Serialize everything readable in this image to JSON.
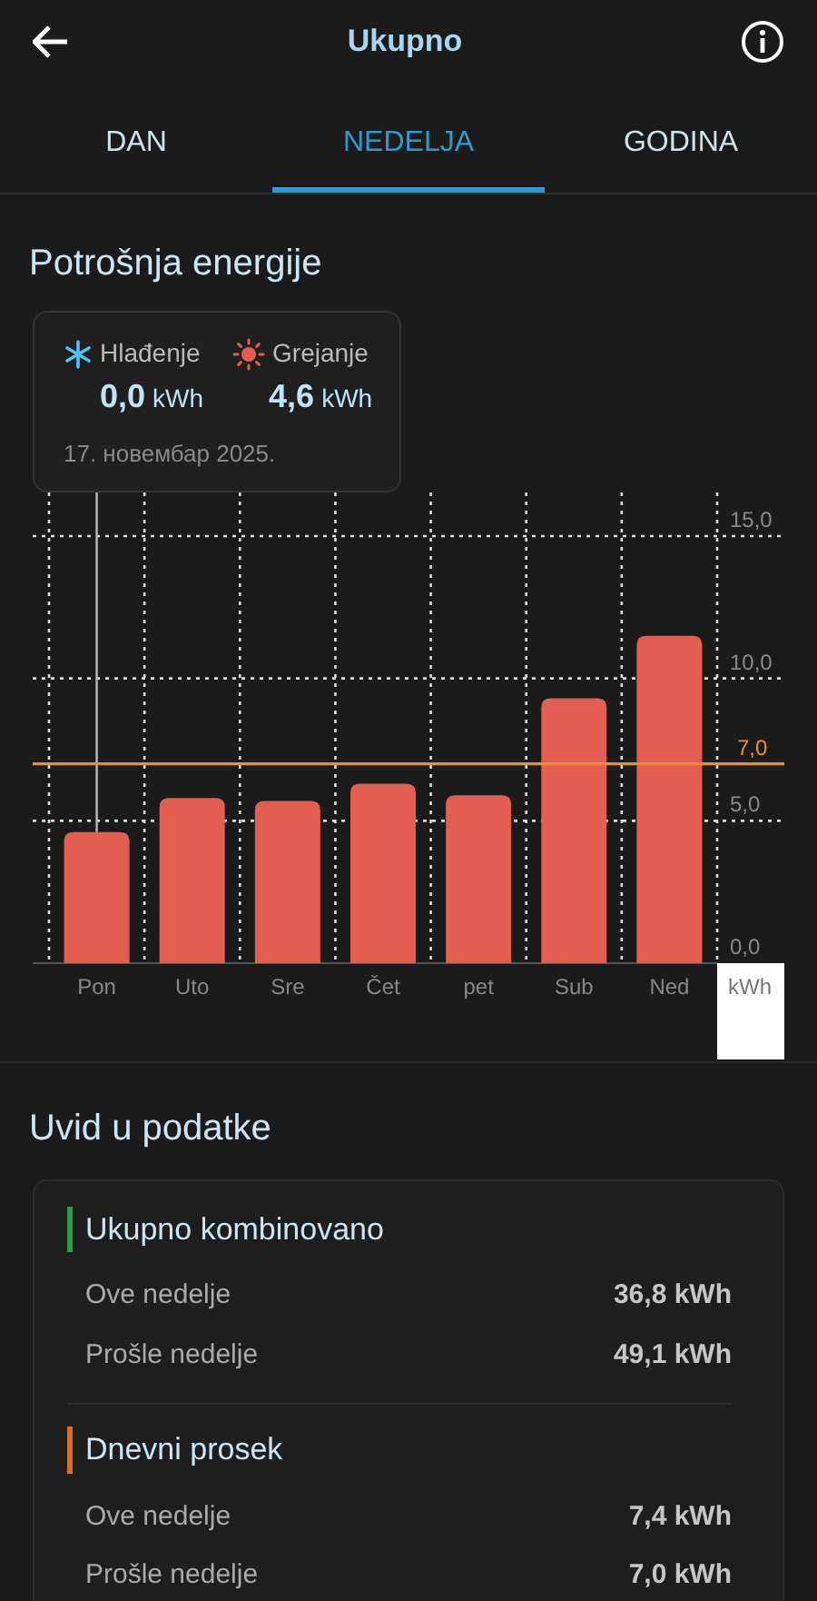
{
  "header": {
    "title": "Ukupno"
  },
  "tabs": [
    {
      "label": "DAN",
      "selected": false
    },
    {
      "label": "NEDELJA",
      "selected": true
    },
    {
      "label": "GODINA",
      "selected": false
    }
  ],
  "consumption": {
    "title": "Potrošnja energije",
    "tooltip": {
      "items": [
        {
          "kind": "cooling",
          "label": "Hlađenje",
          "value": "0,0",
          "unit": "kWh"
        },
        {
          "kind": "heating",
          "label": "Grejanje",
          "value": "4,6",
          "unit": "kWh"
        }
      ],
      "date": "17. новембар 2025."
    },
    "days_selected": [
      true,
      false,
      false,
      false,
      false,
      false,
      false
    ],
    "unit_label": "kWh",
    "chart_data": {
      "type": "bar",
      "categories": [
        "Pon",
        "Uto",
        "Sre",
        "Čet",
        "pet",
        "Sub",
        "Ned"
      ],
      "series": [
        {
          "color": "#e35d50",
          "values": [
            4.6,
            5.8,
            5.7,
            6.3,
            5.9,
            9.3,
            11.5
          ]
        }
      ],
      "ylim": [
        0,
        15
      ],
      "yticks": [
        {
          "value": 0,
          "label": "0,0"
        },
        {
          "value": 5,
          "label": "5,0"
        },
        {
          "value": 10,
          "label": "10,0"
        },
        {
          "value": 15,
          "label": "15,0"
        }
      ],
      "ref_lines": [
        {
          "axis": "y",
          "value": 7,
          "label": "7,0",
          "color": "#e8922d"
        }
      ]
    }
  },
  "insights": {
    "title": "Uvid u podatke",
    "groups": [
      {
        "title": "Ukupno kombinovano",
        "color": "#2e9d4a",
        "rows": [
          {
            "label": "Ove nedelje",
            "value": "36,8 kWh"
          },
          {
            "label": "Prošle nedelje",
            "value": "49,1 kWh"
          }
        ]
      },
      {
        "title": "Dnevni prosek",
        "color": "#d8702a",
        "rows": [
          {
            "label": "Ove nedelje",
            "value": "7,4 kWh"
          },
          {
            "label": "Prošle nedelje",
            "value": "7,0 kWh"
          }
        ]
      }
    ]
  }
}
